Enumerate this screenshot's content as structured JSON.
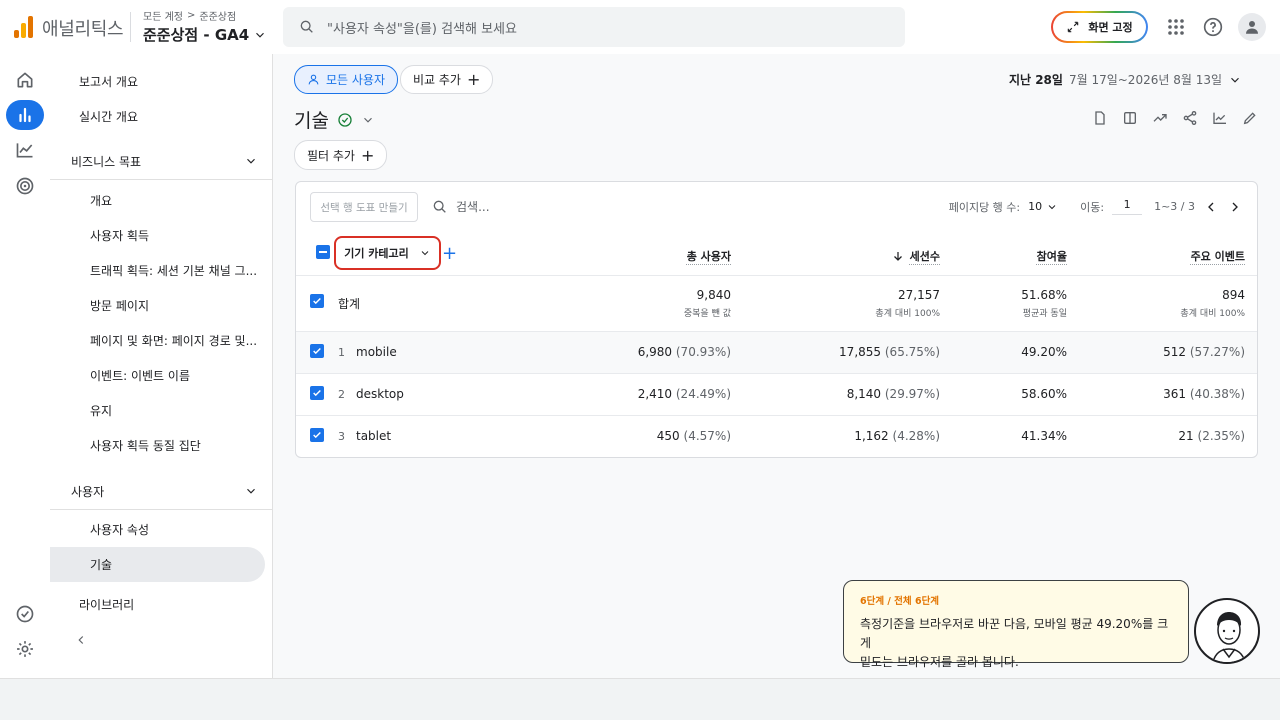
{
  "header": {
    "app_name": "애널리틱스",
    "breadcrumb_account": "모든 계정",
    "breadcrumb_sep": ">",
    "breadcrumb_property": "준준상점",
    "property_name": "준준상점 - GA4",
    "search_placeholder": "\"사용자 속성\"을(를) 검색해 보세요",
    "pin_label": "화면 고정"
  },
  "nav": {
    "report_overview": "보고서 개요",
    "realtime_overview": "실시간 개요",
    "business_section": "비즈니스 목표",
    "business_items": [
      "개요",
      "사용자 획득",
      "트래픽 획득: 세션 기본 채널 그...",
      "방문 페이지",
      "페이지 및 화면: 페이지 경로 및...",
      "이벤트: 이벤트 이름",
      "유지",
      "사용자 획득 동질 집단"
    ],
    "user_section": "사용자",
    "user_items": [
      "사용자 속성",
      "기술"
    ],
    "library": "라이브러리"
  },
  "toolbar": {
    "all_users": "모든 사용자",
    "add_compare": "비교 추가",
    "date_range_label": "지난 28일",
    "date_range": "7월 17일~2026년 8월 13일",
    "page_title": "기술",
    "add_filter": "필터 추가"
  },
  "table": {
    "make_chart": "선택 행 도표 만들기",
    "search_placeholder": "검색...",
    "rows_per_page_label": "페이지당 행 수:",
    "rows_per_page": "10",
    "goto_label": "이동:",
    "goto_value": "1",
    "range": "1~3 / 3",
    "dimension": "기기 카테고리",
    "columns": [
      "총 사용자",
      "세션수",
      "참여율",
      "주요 이벤트"
    ],
    "total": {
      "label": "합계",
      "values": [
        "9,840",
        "27,157",
        "51.68%",
        "894"
      ],
      "notes": [
        "중복을 뺀 값",
        "총계 대비 100%",
        "평균과 동일",
        "총계 대비 100%"
      ]
    },
    "rows": [
      {
        "num": "1",
        "label": "mobile",
        "users": "6,980",
        "users_pct": "(70.93%)",
        "sessions": "17,855",
        "sessions_pct": "(65.75%)",
        "engagement": "49.20%",
        "events": "512",
        "events_pct": "(57.27%)"
      },
      {
        "num": "2",
        "label": "desktop",
        "users": "2,410",
        "users_pct": "(24.49%)",
        "sessions": "8,140",
        "sessions_pct": "(29.97%)",
        "engagement": "58.60%",
        "events": "361",
        "events_pct": "(40.38%)"
      },
      {
        "num": "3",
        "label": "tablet",
        "users": "450",
        "users_pct": "(4.57%)",
        "sessions": "1,162",
        "sessions_pct": "(4.28%)",
        "engagement": "41.34%",
        "events": "21",
        "events_pct": "(2.35%)"
      }
    ]
  },
  "tutor": {
    "step": "6단계 / 전체 6단계",
    "message_line1": "측정기준을 브라우저로 바꾼 다음, 모바일 평균 49.20%를 크게",
    "message_line2": "밑도는 브라우저를 골라 봅니다."
  },
  "colors": {
    "accent": "#1a73e8",
    "highlight_border": "#d93025",
    "bubble_bg": "#fffbe6",
    "step_color": "#e37400"
  }
}
